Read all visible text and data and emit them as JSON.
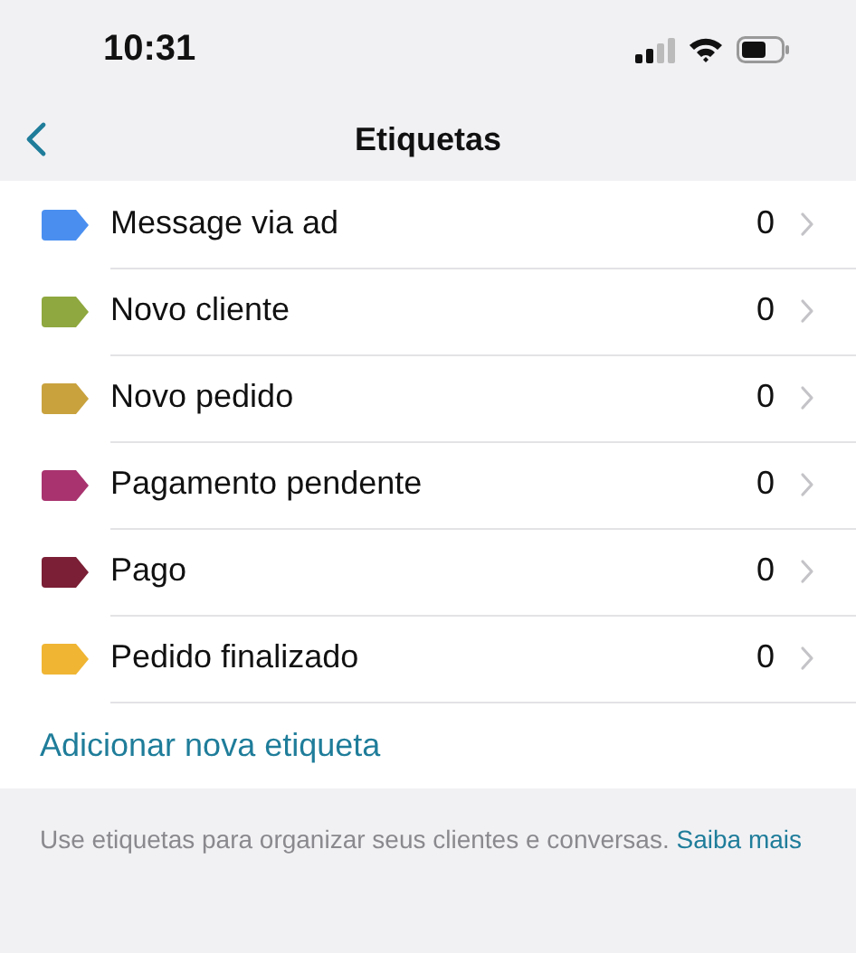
{
  "status_bar": {
    "time": "10:31"
  },
  "nav": {
    "title": "Etiquetas"
  },
  "labels": [
    {
      "name": "Message via ad",
      "count": "0",
      "color": "#4a8ff0"
    },
    {
      "name": "Novo cliente",
      "count": "0",
      "color": "#8fa83f"
    },
    {
      "name": "Novo pedido",
      "count": "0",
      "color": "#c9a23e"
    },
    {
      "name": "Pagamento pendente",
      "count": "0",
      "color": "#a8336f"
    },
    {
      "name": "Pago",
      "count": "0",
      "color": "#7a1f35"
    },
    {
      "name": "Pedido finalizado",
      "count": "0",
      "color": "#f0b533"
    }
  ],
  "add_action": "Adicionar nova etiqueta",
  "footer": {
    "text": "Use etiquetas para organizar seus clientes e conversas.",
    "link": "Saiba mais"
  }
}
